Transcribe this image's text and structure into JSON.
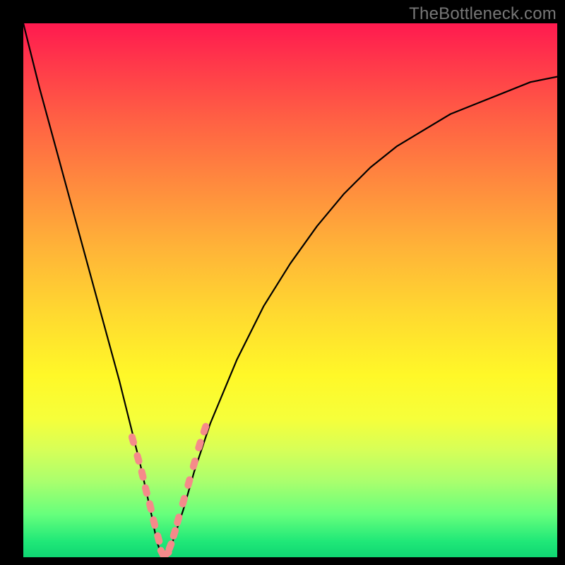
{
  "watermark": "TheBottleneck.com",
  "colors": {
    "frame": "#000000",
    "curve": "#000000",
    "marker_fill": "#f58a8a",
    "marker_stroke": "#c85a5a",
    "gradient_top": "#ff1a4f",
    "gradient_bottom": "#0fd672"
  },
  "chart_data": {
    "type": "line",
    "title": "",
    "xlabel": "",
    "ylabel": "",
    "xlim": [
      0,
      100
    ],
    "ylim": [
      0,
      100
    ],
    "note": "Axes are unlabeled in the image; x and y are normalized 0-100. The curve is a V-shaped bottleneck curve with minimum at x≈26. Values estimated from plotted pixels.",
    "series": [
      {
        "name": "bottleneck-curve",
        "x": [
          0,
          3,
          6,
          9,
          12,
          15,
          18,
          20,
          22,
          24,
          25,
          26,
          27,
          28,
          30,
          32,
          35,
          40,
          45,
          50,
          55,
          60,
          65,
          70,
          75,
          80,
          85,
          90,
          95,
          100
        ],
        "y": [
          100,
          88,
          77,
          66,
          55,
          44,
          33,
          25,
          17,
          8,
          3,
          0,
          0,
          3,
          9,
          16,
          25,
          37,
          47,
          55,
          62,
          68,
          73,
          77,
          80,
          83,
          85,
          87,
          89,
          90
        ]
      }
    ],
    "markers": {
      "name": "highlighted-points",
      "shape": "capsule",
      "x": [
        20.5,
        21.5,
        22.3,
        23.0,
        23.8,
        24.5,
        25.3,
        26.0,
        26.8,
        27.5,
        28.3,
        29.0,
        30.0,
        31.0,
        32.0,
        33.0,
        34.0
      ],
      "y": [
        22.0,
        18.5,
        15.5,
        12.5,
        9.5,
        6.5,
        3.5,
        0.8,
        0.6,
        2.0,
        4.5,
        7.0,
        10.5,
        14.0,
        17.5,
        21.0,
        24.0
      ]
    }
  }
}
